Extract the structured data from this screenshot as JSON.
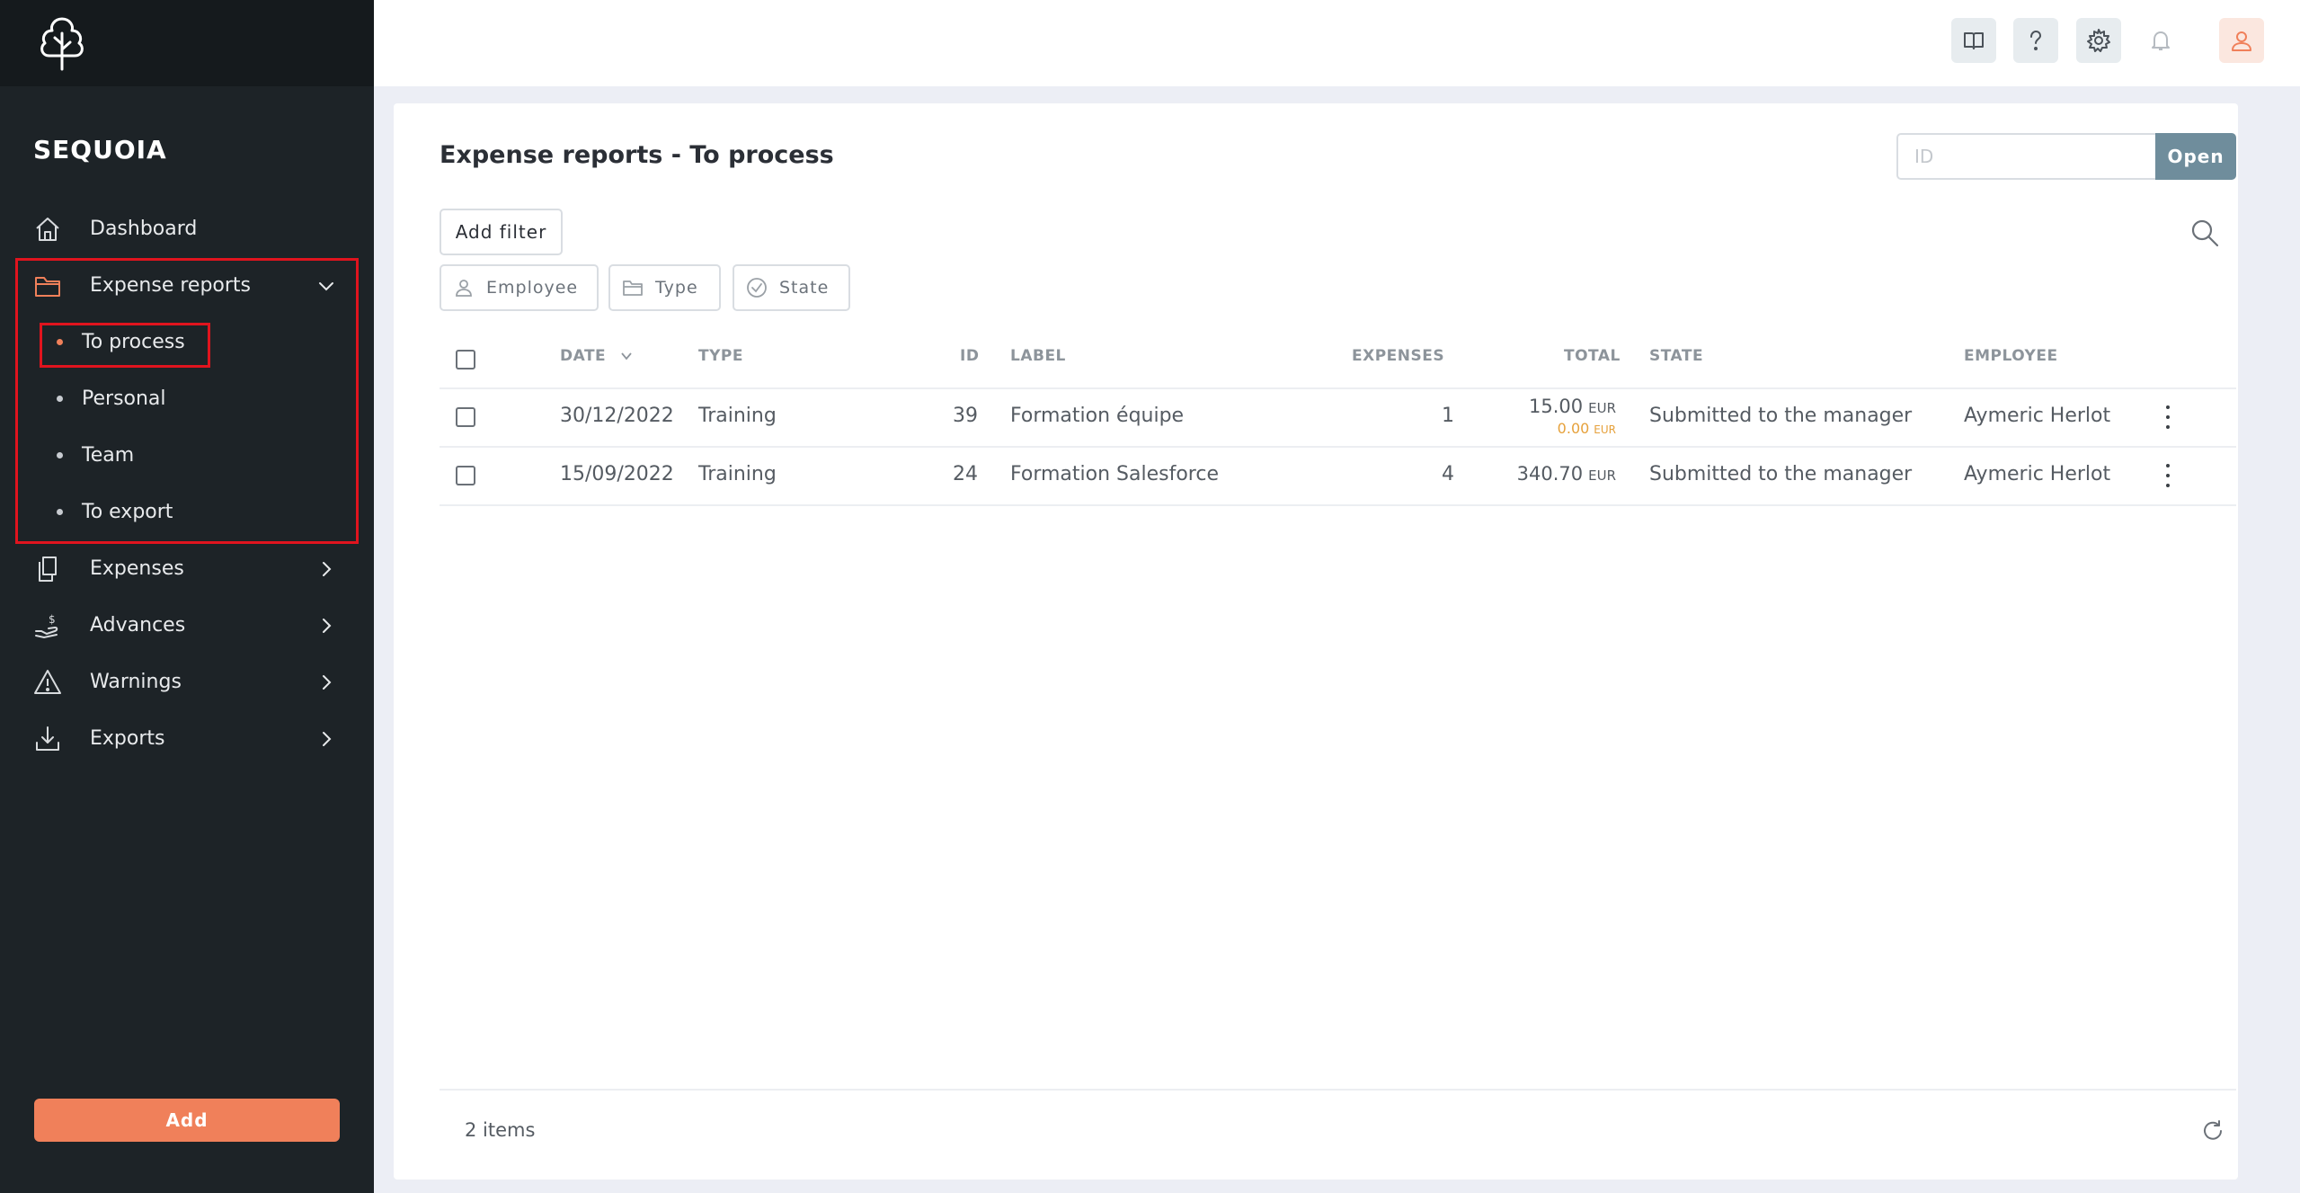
{
  "app": {
    "brand": "SEQUOIA"
  },
  "sidebar": {
    "items": [
      {
        "label": "Dashboard",
        "icon": "home-icon"
      },
      {
        "label": "Expense reports",
        "icon": "folder-icon",
        "expanded": true,
        "children": [
          {
            "label": "To process",
            "active": true
          },
          {
            "label": "Personal"
          },
          {
            "label": "Team"
          },
          {
            "label": "To export"
          }
        ]
      },
      {
        "label": "Expenses",
        "icon": "documents-icon"
      },
      {
        "label": "Advances",
        "icon": "hand-coin-icon"
      },
      {
        "label": "Warnings",
        "icon": "warning-icon"
      },
      {
        "label": "Exports",
        "icon": "download-icon"
      }
    ],
    "add_label": "Add"
  },
  "topbar": {
    "icons": [
      "book-icon",
      "help-icon",
      "gear-icon",
      "bell-icon",
      "user-icon"
    ]
  },
  "main": {
    "title": "Expense reports - To process",
    "id_search": {
      "placeholder": "ID",
      "button": "Open"
    },
    "add_filter_label": "Add filter",
    "chips": [
      {
        "label": "Employee",
        "icon": "person-icon"
      },
      {
        "label": "Type",
        "icon": "folder-icon"
      },
      {
        "label": "State",
        "icon": "check-circle-icon"
      }
    ],
    "table": {
      "headers": {
        "date": "DATE",
        "type": "TYPE",
        "id": "ID",
        "label": "LABEL",
        "expenses": "EXPENSES",
        "total": "TOTAL",
        "state": "STATE",
        "employee": "EMPLOYEE"
      },
      "rows": [
        {
          "date": "30/12/2022",
          "type": "Training",
          "id": "39",
          "label": "Formation équipe",
          "expenses": "1",
          "total": "15.00",
          "currency": "EUR",
          "sub_total": "0.00",
          "sub_currency": "EUR",
          "state": "Submitted to the manager",
          "employee": "Aymeric Herlot"
        },
        {
          "date": "15/09/2022",
          "type": "Training",
          "id": "24",
          "label": "Formation Salesforce",
          "expenses": "4",
          "total": "340.70",
          "currency": "EUR",
          "state": "Submitted to the manager",
          "employee": "Aymeric Herlot"
        }
      ]
    },
    "footer": {
      "count": "2 items"
    }
  },
  "colors": {
    "accent": "#f0805a",
    "sidebar_bg": "#1d2327",
    "open_button": "#6f8d9c",
    "highlight": "#e0141e"
  }
}
